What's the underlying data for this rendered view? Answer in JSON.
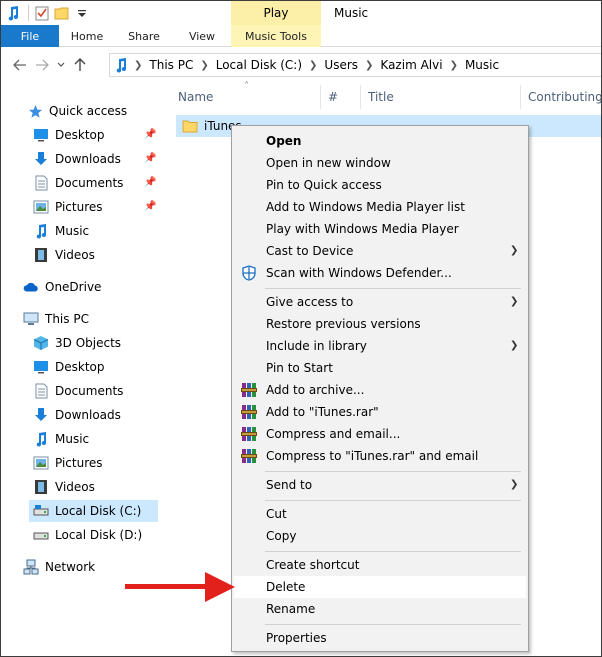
{
  "window": {
    "title": "Music",
    "context_tab_group": "Play"
  },
  "ribbon": {
    "tabs": [
      {
        "label": "File"
      },
      {
        "label": "Home"
      },
      {
        "label": "Share"
      },
      {
        "label": "View"
      },
      {
        "label": "Music Tools"
      }
    ]
  },
  "address": {
    "crumbs": [
      "This PC",
      "Local Disk (C:)",
      "Users",
      "Kazim Alvi",
      "Music"
    ]
  },
  "nav": {
    "items": [
      {
        "label": "Quick access"
      },
      {
        "label": "Desktop"
      },
      {
        "label": "Downloads"
      },
      {
        "label": "Documents"
      },
      {
        "label": "Pictures"
      },
      {
        "label": "Music"
      },
      {
        "label": "Videos"
      },
      {
        "label": "OneDrive"
      },
      {
        "label": "This PC"
      },
      {
        "label": "3D Objects"
      },
      {
        "label": "Desktop"
      },
      {
        "label": "Documents"
      },
      {
        "label": "Downloads"
      },
      {
        "label": "Music"
      },
      {
        "label": "Pictures"
      },
      {
        "label": "Videos"
      },
      {
        "label": "Local Disk (C:)"
      },
      {
        "label": "Local Disk (D:)"
      },
      {
        "label": "Network"
      }
    ]
  },
  "list": {
    "columns": [
      "Name",
      "#",
      "Title",
      "Contributing a"
    ],
    "rows": [
      {
        "name": "iTunes"
      }
    ]
  },
  "context_menu": {
    "items": [
      {
        "label": "Open"
      },
      {
        "label": "Open in new window"
      },
      {
        "label": "Pin to Quick access"
      },
      {
        "label": "Add to Windows Media Player list"
      },
      {
        "label": "Play with Windows Media Player"
      },
      {
        "label": "Cast to Device"
      },
      {
        "label": "Scan with Windows Defender..."
      },
      {
        "label": "Give access to"
      },
      {
        "label": "Restore previous versions"
      },
      {
        "label": "Include in library"
      },
      {
        "label": "Pin to Start"
      },
      {
        "label": "Add to archive..."
      },
      {
        "label": "Add to \"iTunes.rar\""
      },
      {
        "label": "Compress and email..."
      },
      {
        "label": "Compress to \"iTunes.rar\" and email"
      },
      {
        "label": "Send to"
      },
      {
        "label": "Cut"
      },
      {
        "label": "Copy"
      },
      {
        "label": "Create shortcut"
      },
      {
        "label": "Delete"
      },
      {
        "label": "Rename"
      },
      {
        "label": "Properties"
      }
    ]
  },
  "colors": {
    "file_tab": "#1979ca",
    "selection": "#cce8ff",
    "context_tab": "#fdf4b6",
    "annotation_arrow": "#e3211c"
  }
}
